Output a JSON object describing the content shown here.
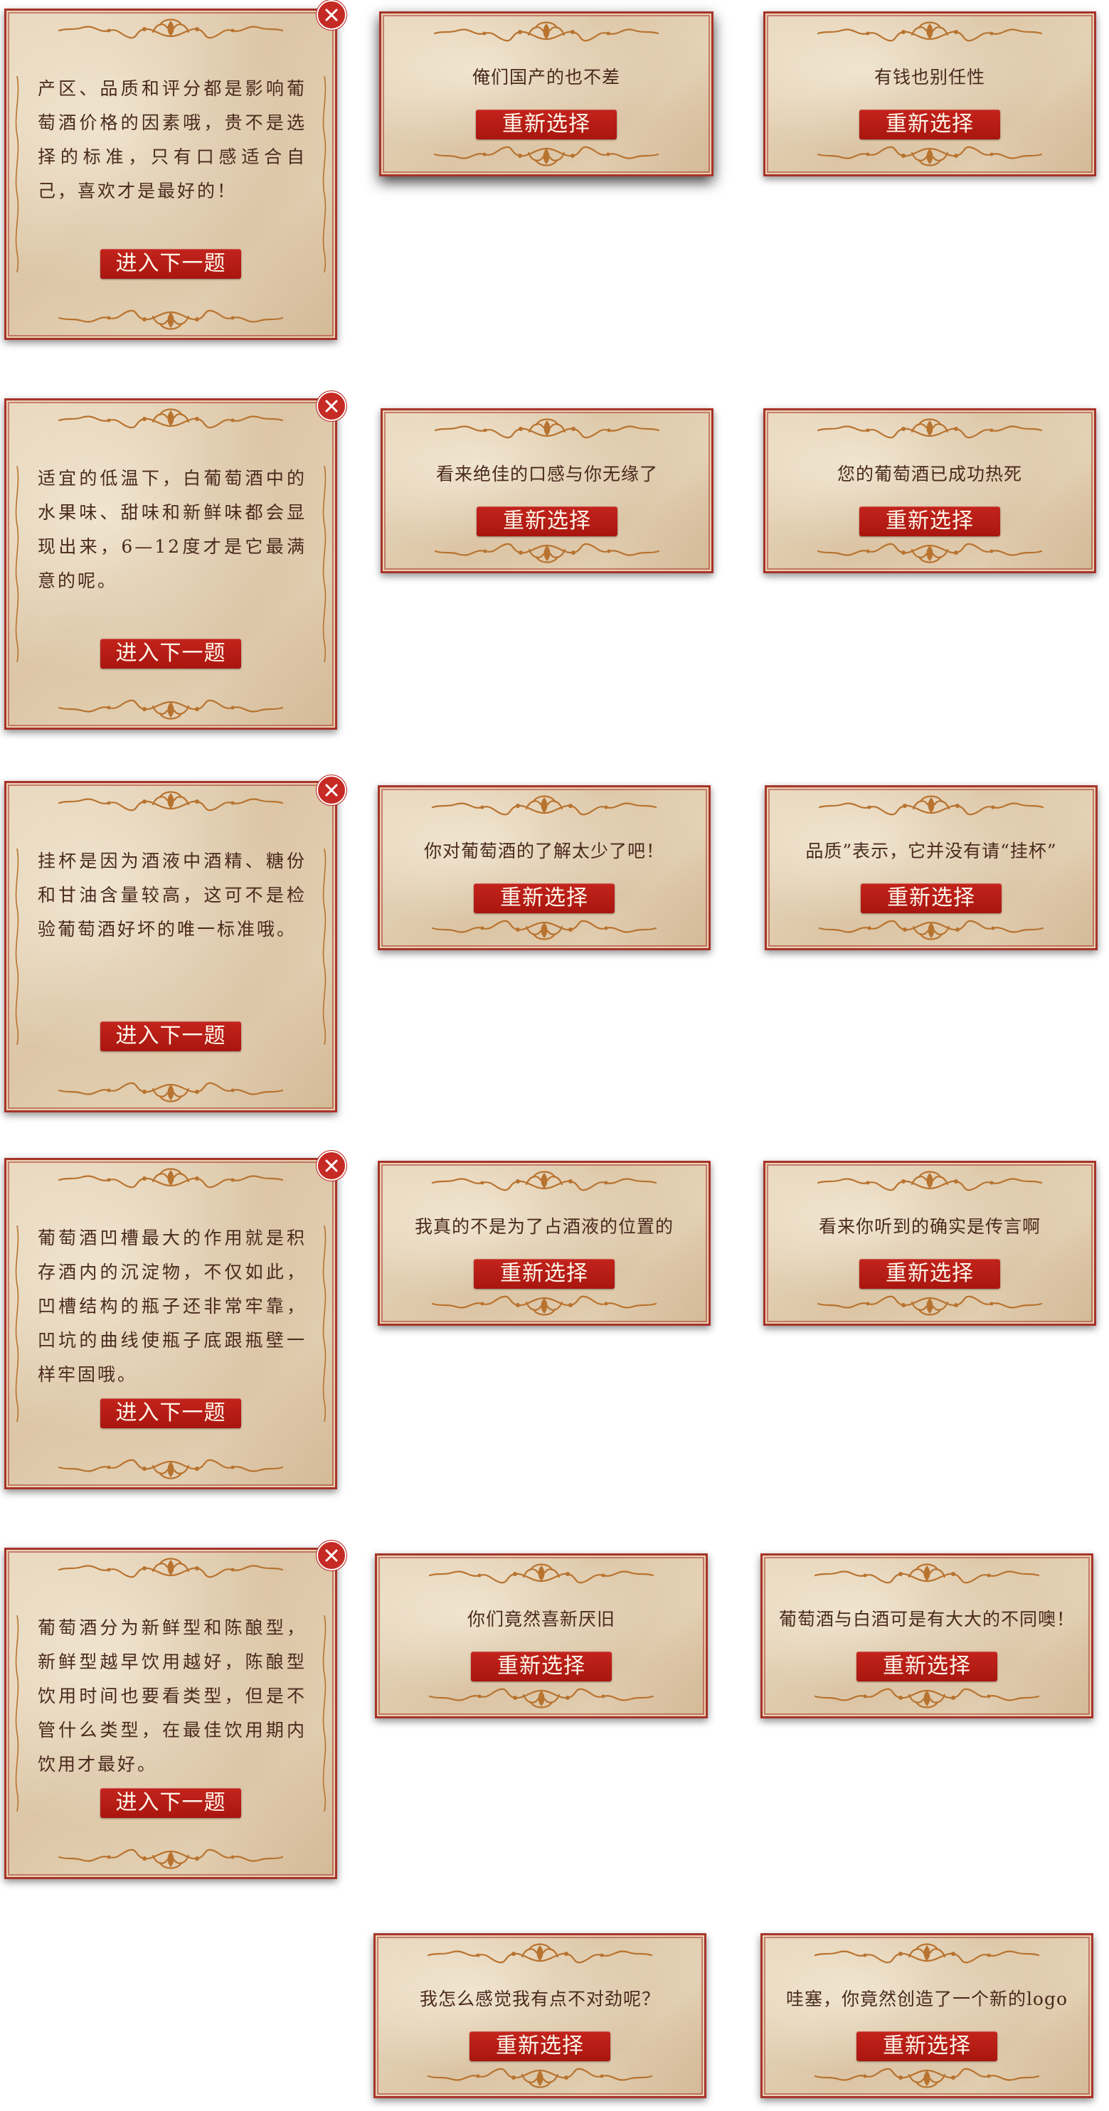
{
  "colors": {
    "accent": "#b3150f",
    "card_bg": "#e2cfb2",
    "border": "#a8342a",
    "text": "#4a2a1e",
    "ornament": "#b8732f"
  },
  "icons": {
    "close": "close-icon",
    "ornament": "ornament-icon"
  },
  "buttons": {
    "next": "进入下一题",
    "retry": "重新选择"
  },
  "rows": [
    {
      "explanation": "产区、品质和评分都是影响葡萄酒价格的因素哦，贵不是选择的标准，只有口感适合自己，喜欢才是最好的！",
      "wrong_a": "俺们国产的也不差",
      "wrong_b": "有钱也别任性"
    },
    {
      "explanation": "适宜的低温下，白葡萄酒中的水果味、甜味和新鲜味都会显现出来，6—12度才是它最满意的呢。",
      "wrong_a": "看来绝佳的口感与你无缘了",
      "wrong_b": "您的葡萄酒已成功热死"
    },
    {
      "explanation": "挂杯是因为酒液中酒精、糖份和甘油含量较高，这可不是检验葡萄酒好坏的唯一标准哦。",
      "wrong_a": "你对葡萄酒的了解太少了吧！",
      "wrong_b": "品质”表示，它并没有请“挂杯”"
    },
    {
      "explanation": "葡萄酒凹槽最大的作用就是积存酒内的沉淀物，不仅如此，凹槽结构的瓶子还非常牢靠，凹坑的曲线使瓶子底跟瓶壁一样牢固哦。",
      "wrong_a": "我真的不是为了占酒液的位置的",
      "wrong_b": "看来你听到的确实是传言啊"
    },
    {
      "explanation": "葡萄酒分为新鲜型和陈酿型，新鲜型越早饮用越好，陈酿型饮用时间也要看类型，但是不管什么类型，在最佳饮用期内饮用才最好。",
      "wrong_a": "你们竟然喜新厌旧",
      "wrong_b": "葡萄酒与白酒可是有大大的不同噢！"
    }
  ],
  "extra": {
    "wrong_a": "我怎么感觉我有点不对劲呢？",
    "wrong_b": "哇塞，你竟然创造了一个新的logo"
  }
}
